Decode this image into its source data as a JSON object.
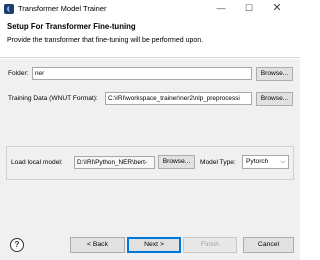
{
  "window": {
    "title": "Transformer Model Trainer",
    "minimize": "—",
    "maximize": "☐",
    "close": "✕"
  },
  "header": {
    "title": "Setup For Transformer Fine-tuning",
    "description": "Provide the transformer that fine-tuning will be performed upon."
  },
  "form": {
    "folder_label": "Folder:",
    "folder_value": "ner",
    "folder_browse": "Browse...",
    "training_label": "Training Data (WNUT Format):",
    "training_value": "C:\\IRI\\workspace_trainer\\ner2\\nlp_preprocessi",
    "training_browse": "Browse...",
    "local_model_label": "Load local model:",
    "local_model_value": "D:\\IRI\\Python_NER\\bert-",
    "local_model_browse": "Browse...",
    "model_type_label": "Model Type:",
    "model_type_value": "Pytorch"
  },
  "footer": {
    "help": "?",
    "back": "< Back",
    "next": "Next >",
    "finish": "Finish",
    "cancel": "Cancel"
  }
}
